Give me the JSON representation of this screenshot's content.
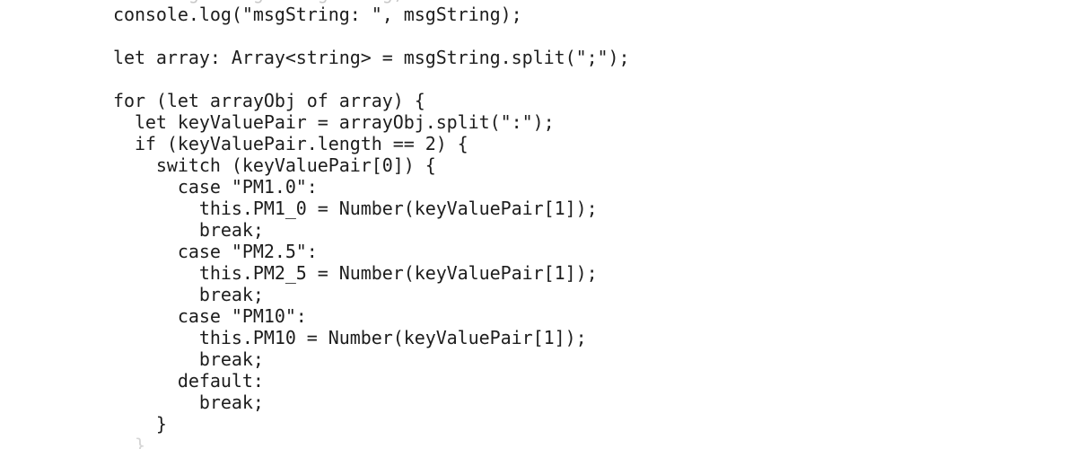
{
  "document": {
    "kind": "source-code-screenshot",
    "language": "TypeScript",
    "background_color": "#ffffff",
    "text_color": "#1d1d1d",
    "clipped_top_color": "#c9c9c9",
    "clipped_bottom_color": "#d5d5d5"
  },
  "code": {
    "lines": [
      {
        "text": "    this.msgString = msgString;",
        "state": "clipped-top"
      },
      {
        "text": "    console.log(\"msgString: \", msgString);",
        "state": "normal"
      },
      {
        "text": "",
        "state": "blank"
      },
      {
        "text": "    let array: Array<string> = msgString.split(\";\");",
        "state": "normal"
      },
      {
        "text": "",
        "state": "blank"
      },
      {
        "text": "    for (let arrayObj of array) {",
        "state": "normal"
      },
      {
        "text": "      let keyValuePair = arrayObj.split(\":\");",
        "state": "normal"
      },
      {
        "text": "      if (keyValuePair.length == 2) {",
        "state": "normal"
      },
      {
        "text": "        switch (keyValuePair[0]) {",
        "state": "normal"
      },
      {
        "text": "          case \"PM1.0\":",
        "state": "normal"
      },
      {
        "text": "            this.PM1_0 = Number(keyValuePair[1]);",
        "state": "normal"
      },
      {
        "text": "            break;",
        "state": "normal"
      },
      {
        "text": "          case \"PM2.5\":",
        "state": "normal"
      },
      {
        "text": "            this.PM2_5 = Number(keyValuePair[1]);",
        "state": "normal"
      },
      {
        "text": "            break;",
        "state": "normal"
      },
      {
        "text": "          case \"PM10\":",
        "state": "normal"
      },
      {
        "text": "            this.PM10 = Number(keyValuePair[1]);",
        "state": "normal"
      },
      {
        "text": "            break;",
        "state": "normal"
      },
      {
        "text": "          default:",
        "state": "normal"
      },
      {
        "text": "            break;",
        "state": "normal"
      },
      {
        "text": "        }",
        "state": "normal"
      },
      {
        "text": "      }",
        "state": "clipped-bottom"
      }
    ]
  }
}
